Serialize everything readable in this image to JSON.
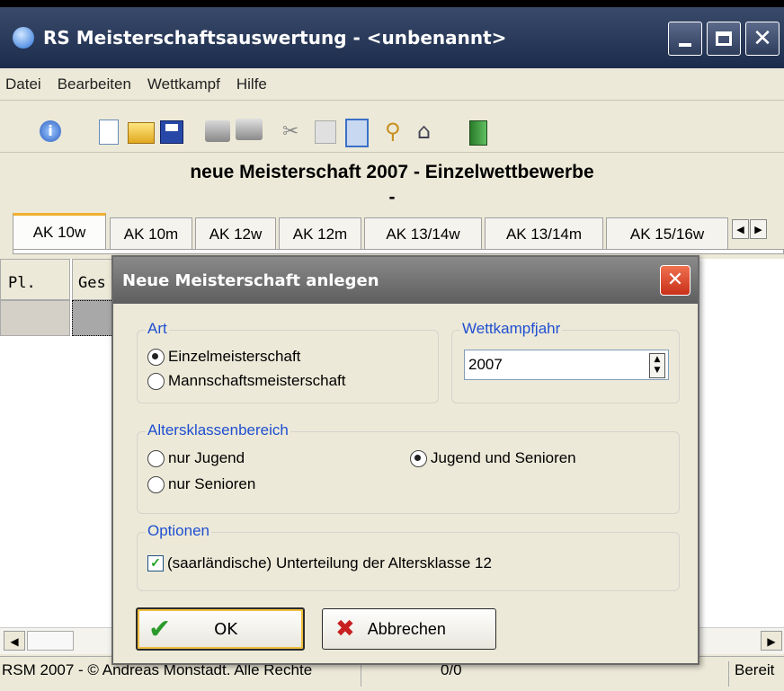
{
  "window": {
    "title": "RS Meisterschaftsauswertung - <unbenannt>"
  },
  "menu": [
    "Datei",
    "Bearbeiten",
    "Wettkampf",
    "Hilfe"
  ],
  "toolbar_icons": [
    "info-icon",
    "new-file-icon",
    "open-folder-icon",
    "save-icon",
    "print-icon",
    "print-preview-icon",
    "cut-icon",
    "copy-icon",
    "paste-icon",
    "search-icon",
    "home-icon",
    "exit-icon"
  ],
  "heading": {
    "line1": "neue Meisterschaft 2007 - Einzelwettbewerbe",
    "line2": "-"
  },
  "tabs": [
    "AK 10w",
    "AK 10m",
    "AK 12w",
    "AK 12m",
    "AK 13/14w",
    "AK 13/14m",
    "AK 15/16w"
  ],
  "grid": {
    "col1": "Pl.",
    "col2": "Ges"
  },
  "status": {
    "left": "RSM 2007 - © Andreas Monstadt. Alle Rechte",
    "middle": "0/0",
    "right": "Bereit"
  },
  "dialog": {
    "title": "Neue Meisterschaft anlegen",
    "art": {
      "label": "Art",
      "opt1": "Einzelmeisterschaft",
      "opt2": "Mannschaftsmeisterschaft",
      "selected": "Einzelmeisterschaft"
    },
    "jahr": {
      "label": "Wettkampfjahr",
      "value": "2007"
    },
    "alter": {
      "label": "Altersklassenbereich",
      "opt1": "nur Jugend",
      "opt2": "nur Senioren",
      "opt3": "Jugend und Senioren",
      "selected": "Jugend und Senioren"
    },
    "optionen": {
      "label": "Optionen",
      "check": "(saarländische) Unterteilung der Altersklasse 12",
      "checked": true
    },
    "ok": "OK",
    "cancel": "Abbrechen"
  }
}
